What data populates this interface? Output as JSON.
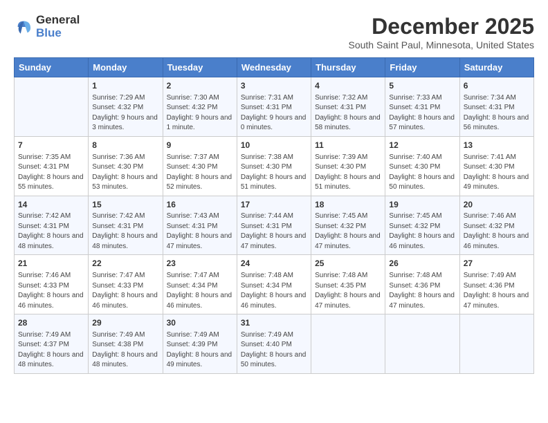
{
  "app": {
    "logo_line1": "General",
    "logo_line2": "Blue"
  },
  "calendar": {
    "title": "December 2025",
    "subtitle": "South Saint Paul, Minnesota, United States",
    "days_of_week": [
      "Sunday",
      "Monday",
      "Tuesday",
      "Wednesday",
      "Thursday",
      "Friday",
      "Saturday"
    ],
    "weeks": [
      [
        {
          "day": "",
          "sunrise": "",
          "sunset": "",
          "daylight": ""
        },
        {
          "day": "1",
          "sunrise": "Sunrise: 7:29 AM",
          "sunset": "Sunset: 4:32 PM",
          "daylight": "Daylight: 9 hours and 3 minutes."
        },
        {
          "day": "2",
          "sunrise": "Sunrise: 7:30 AM",
          "sunset": "Sunset: 4:32 PM",
          "daylight": "Daylight: 9 hours and 1 minute."
        },
        {
          "day": "3",
          "sunrise": "Sunrise: 7:31 AM",
          "sunset": "Sunset: 4:31 PM",
          "daylight": "Daylight: 9 hours and 0 minutes."
        },
        {
          "day": "4",
          "sunrise": "Sunrise: 7:32 AM",
          "sunset": "Sunset: 4:31 PM",
          "daylight": "Daylight: 8 hours and 58 minutes."
        },
        {
          "day": "5",
          "sunrise": "Sunrise: 7:33 AM",
          "sunset": "Sunset: 4:31 PM",
          "daylight": "Daylight: 8 hours and 57 minutes."
        },
        {
          "day": "6",
          "sunrise": "Sunrise: 7:34 AM",
          "sunset": "Sunset: 4:31 PM",
          "daylight": "Daylight: 8 hours and 56 minutes."
        }
      ],
      [
        {
          "day": "7",
          "sunrise": "Sunrise: 7:35 AM",
          "sunset": "Sunset: 4:31 PM",
          "daylight": "Daylight: 8 hours and 55 minutes."
        },
        {
          "day": "8",
          "sunrise": "Sunrise: 7:36 AM",
          "sunset": "Sunset: 4:30 PM",
          "daylight": "Daylight: 8 hours and 53 minutes."
        },
        {
          "day": "9",
          "sunrise": "Sunrise: 7:37 AM",
          "sunset": "Sunset: 4:30 PM",
          "daylight": "Daylight: 8 hours and 52 minutes."
        },
        {
          "day": "10",
          "sunrise": "Sunrise: 7:38 AM",
          "sunset": "Sunset: 4:30 PM",
          "daylight": "Daylight: 8 hours and 51 minutes."
        },
        {
          "day": "11",
          "sunrise": "Sunrise: 7:39 AM",
          "sunset": "Sunset: 4:30 PM",
          "daylight": "Daylight: 8 hours and 51 minutes."
        },
        {
          "day": "12",
          "sunrise": "Sunrise: 7:40 AM",
          "sunset": "Sunset: 4:30 PM",
          "daylight": "Daylight: 8 hours and 50 minutes."
        },
        {
          "day": "13",
          "sunrise": "Sunrise: 7:41 AM",
          "sunset": "Sunset: 4:30 PM",
          "daylight": "Daylight: 8 hours and 49 minutes."
        }
      ],
      [
        {
          "day": "14",
          "sunrise": "Sunrise: 7:42 AM",
          "sunset": "Sunset: 4:31 PM",
          "daylight": "Daylight: 8 hours and 48 minutes."
        },
        {
          "day": "15",
          "sunrise": "Sunrise: 7:42 AM",
          "sunset": "Sunset: 4:31 PM",
          "daylight": "Daylight: 8 hours and 48 minutes."
        },
        {
          "day": "16",
          "sunrise": "Sunrise: 7:43 AM",
          "sunset": "Sunset: 4:31 PM",
          "daylight": "Daylight: 8 hours and 47 minutes."
        },
        {
          "day": "17",
          "sunrise": "Sunrise: 7:44 AM",
          "sunset": "Sunset: 4:31 PM",
          "daylight": "Daylight: 8 hours and 47 minutes."
        },
        {
          "day": "18",
          "sunrise": "Sunrise: 7:45 AM",
          "sunset": "Sunset: 4:32 PM",
          "daylight": "Daylight: 8 hours and 47 minutes."
        },
        {
          "day": "19",
          "sunrise": "Sunrise: 7:45 AM",
          "sunset": "Sunset: 4:32 PM",
          "daylight": "Daylight: 8 hours and 46 minutes."
        },
        {
          "day": "20",
          "sunrise": "Sunrise: 7:46 AM",
          "sunset": "Sunset: 4:32 PM",
          "daylight": "Daylight: 8 hours and 46 minutes."
        }
      ],
      [
        {
          "day": "21",
          "sunrise": "Sunrise: 7:46 AM",
          "sunset": "Sunset: 4:33 PM",
          "daylight": "Daylight: 8 hours and 46 minutes."
        },
        {
          "day": "22",
          "sunrise": "Sunrise: 7:47 AM",
          "sunset": "Sunset: 4:33 PM",
          "daylight": "Daylight: 8 hours and 46 minutes."
        },
        {
          "day": "23",
          "sunrise": "Sunrise: 7:47 AM",
          "sunset": "Sunset: 4:34 PM",
          "daylight": "Daylight: 8 hours and 46 minutes."
        },
        {
          "day": "24",
          "sunrise": "Sunrise: 7:48 AM",
          "sunset": "Sunset: 4:34 PM",
          "daylight": "Daylight: 8 hours and 46 minutes."
        },
        {
          "day": "25",
          "sunrise": "Sunrise: 7:48 AM",
          "sunset": "Sunset: 4:35 PM",
          "daylight": "Daylight: 8 hours and 47 minutes."
        },
        {
          "day": "26",
          "sunrise": "Sunrise: 7:48 AM",
          "sunset": "Sunset: 4:36 PM",
          "daylight": "Daylight: 8 hours and 47 minutes."
        },
        {
          "day": "27",
          "sunrise": "Sunrise: 7:49 AM",
          "sunset": "Sunset: 4:36 PM",
          "daylight": "Daylight: 8 hours and 47 minutes."
        }
      ],
      [
        {
          "day": "28",
          "sunrise": "Sunrise: 7:49 AM",
          "sunset": "Sunset: 4:37 PM",
          "daylight": "Daylight: 8 hours and 48 minutes."
        },
        {
          "day": "29",
          "sunrise": "Sunrise: 7:49 AM",
          "sunset": "Sunset: 4:38 PM",
          "daylight": "Daylight: 8 hours and 48 minutes."
        },
        {
          "day": "30",
          "sunrise": "Sunrise: 7:49 AM",
          "sunset": "Sunset: 4:39 PM",
          "daylight": "Daylight: 8 hours and 49 minutes."
        },
        {
          "day": "31",
          "sunrise": "Sunrise: 7:49 AM",
          "sunset": "Sunset: 4:40 PM",
          "daylight": "Daylight: 8 hours and 50 minutes."
        },
        {
          "day": "",
          "sunrise": "",
          "sunset": "",
          "daylight": ""
        },
        {
          "day": "",
          "sunrise": "",
          "sunset": "",
          "daylight": ""
        },
        {
          "day": "",
          "sunrise": "",
          "sunset": "",
          "daylight": ""
        }
      ]
    ]
  }
}
